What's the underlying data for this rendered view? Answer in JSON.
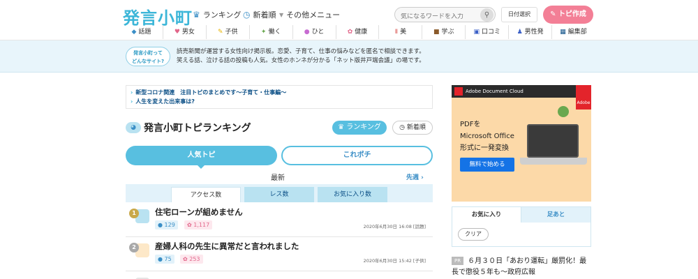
{
  "header": {
    "logo": "発言小町",
    "nav": [
      {
        "label": "ランキング",
        "icon": "crown-icon"
      },
      {
        "label": "新着順",
        "icon": "clock-icon"
      },
      {
        "label": "その他メニュー",
        "icon": "chevron-down-icon"
      }
    ],
    "search_placeholder": "気になるワードを入力",
    "date_select": "日付選択",
    "post_button": "トピ作成"
  },
  "categories": [
    {
      "label": "話題",
      "icon": "talk-icon"
    },
    {
      "label": "男女",
      "icon": "heart-icon"
    },
    {
      "label": "子供",
      "icon": "pencil-icon"
    },
    {
      "label": "働く",
      "icon": "work-icon"
    },
    {
      "label": "ひと",
      "icon": "person-icon"
    },
    {
      "label": "健康",
      "icon": "health-icon"
    },
    {
      "label": "美",
      "icon": "beauty-icon"
    },
    {
      "label": "学ぶ",
      "icon": "book-icon"
    },
    {
      "label": "口コミ",
      "icon": "cart-icon"
    },
    {
      "label": "男性発",
      "icon": "man-icon"
    },
    {
      "label": "編集部",
      "icon": "editor-icon"
    }
  ],
  "about": {
    "badge_line1": "発言小町って",
    "badge_line2": "どんなサイト?",
    "text_line1": "読売新聞が運営する女性向け掲示板。恋愛、子育て、仕事の悩みなどを匿名で相談できます。",
    "text_line2": "笑える話、泣ける話の投稿も人気。女性のホンネが分かる「ネット版井戸端会議」の場です。"
  },
  "notices": [
    "新型コロナ関連　注目トピのまとめです～子育て・仕事編～",
    "人生を変えた出来事は?"
  ],
  "ranking": {
    "title": "発言小町トピランキング",
    "ranking_button": "ランキング",
    "new_button": "新着順",
    "tab_popular": "人気トピ",
    "tab_kore": "これポチ",
    "period": "最新",
    "prev_week": "先週",
    "subtabs": [
      "アクセス数",
      "レス数",
      "お気に入り数"
    ],
    "rows": [
      {
        "rank": "1",
        "title": "住宅ローンが組めません",
        "res": "129",
        "fav": "1,117",
        "date": "2020年6月30日 16:08",
        "category": "[話題]"
      },
      {
        "rank": "2",
        "title": "産婦人科の先生に異常だと言われました",
        "res": "75",
        "fav": "253",
        "date": "2020年6月30日 15:42",
        "category": "[子供]"
      }
    ]
  },
  "ad": {
    "brand": "Adobe Document Cloud",
    "corner": "Adobe",
    "headline_1": "PDFを",
    "headline_2": "Microsoft Office",
    "headline_3": "形式に一発変換",
    "cta": "無料で始める"
  },
  "favorites": {
    "tab_a": "お気に入り",
    "tab_b": "足あと",
    "clear": "クリア"
  },
  "pr": {
    "tag": "PR",
    "text": "６月３０日「あおり運転」厳罰化！最長で懲役５年も～政府広報"
  },
  "colors": {
    "accent": "#58bfe0",
    "post": "#f37f96",
    "link": "#0b4f86"
  }
}
